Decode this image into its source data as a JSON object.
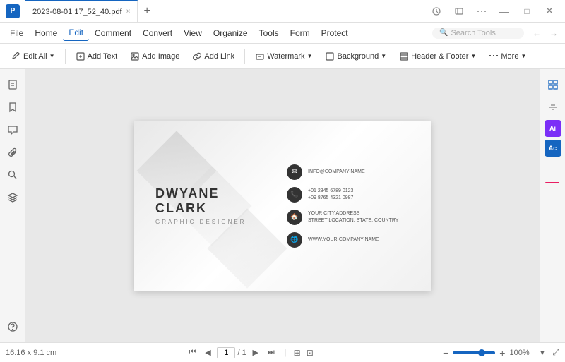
{
  "titlebar": {
    "logo_text": "P",
    "tab_filename": "2023-08-01 17_52_40.pdf",
    "tab_close_label": "×",
    "tab_new_label": "+",
    "window_minimize": "—",
    "window_maximize": "□",
    "window_close": "×"
  },
  "menubar": {
    "items": [
      "File",
      "Home",
      "Edit",
      "Comment",
      "Convert",
      "View",
      "Organize",
      "Tools",
      "Form",
      "Protect"
    ],
    "active_item": "Edit",
    "search_placeholder": "Search Tools"
  },
  "toolbar": {
    "edit_all_label": "Edit All",
    "add_text_label": "Add Text",
    "add_image_label": "Add Image",
    "add_link_label": "Add Link",
    "watermark_label": "Watermark",
    "background_label": "Background",
    "header_footer_label": "Header & Footer",
    "more_label": "More"
  },
  "left_sidebar": {
    "icons": [
      "page",
      "bookmark",
      "comment",
      "attachment",
      "search",
      "layers",
      "help"
    ]
  },
  "business_card": {
    "name_first": "DWYANE",
    "name_last": "CLARK",
    "job_title": "GRAPHIC DESIGNER",
    "email": "INFO@COMPANY-NAME",
    "phone1": "+01 2345 6789 0123",
    "phone2": "+09 8765 4321 0987",
    "address1": "YOUR CITY ADDRESS",
    "address2": "STREET LOCATION, STATE, COUNTRY",
    "website": "WWW.YOUR-COMPANY-NAME"
  },
  "right_sidebar": {
    "ai_label_1": "Ai",
    "ai_label_2": "Ac"
  },
  "statusbar": {
    "dimensions": "16.16 x 9.1 cm",
    "page_current": "1",
    "page_total": "1",
    "zoom_level": "100%"
  }
}
